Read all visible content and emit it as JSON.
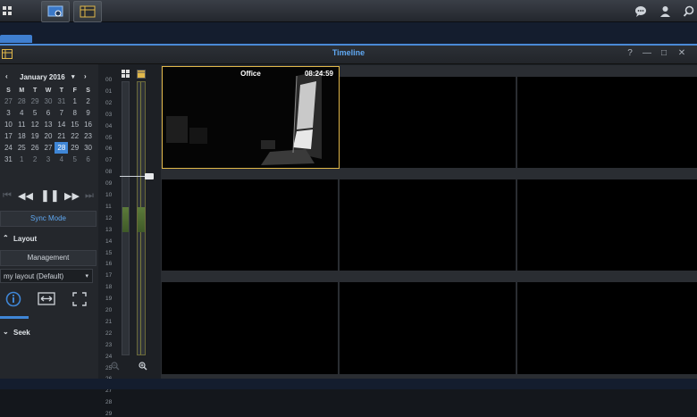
{
  "calendar": {
    "month_year": "January 2016",
    "weekdays": [
      "S",
      "M",
      "T",
      "W",
      "T",
      "F",
      "S"
    ],
    "weeks": [
      [
        "27",
        "28",
        "29",
        "30",
        "31",
        "1",
        "2"
      ],
      [
        "3",
        "4",
        "5",
        "6",
        "7",
        "8",
        "9"
      ],
      [
        "10",
        "11",
        "12",
        "13",
        "14",
        "15",
        "16"
      ],
      [
        "17",
        "18",
        "19",
        "20",
        "21",
        "22",
        "23"
      ],
      [
        "24",
        "25",
        "26",
        "27",
        "28",
        "29",
        "30"
      ],
      [
        "31",
        "1",
        "2",
        "3",
        "4",
        "5",
        "6"
      ]
    ],
    "selected_day": "28"
  },
  "left_panel": {
    "sync_mode": "Sync Mode",
    "layout_section": "Layout",
    "management": "Management",
    "layout_select": "my layout (Default)",
    "seek_section": "Seek"
  },
  "window": {
    "title": "Timeline"
  },
  "hours": [
    "00",
    "01",
    "02",
    "03",
    "04",
    "05",
    "06",
    "07",
    "08",
    "09",
    "10",
    "11",
    "12",
    "13",
    "14",
    "15",
    "16",
    "17",
    "18",
    "19",
    "20",
    "21",
    "22",
    "23",
    "24",
    "25",
    "26",
    "27",
    "28",
    "29"
  ],
  "camera": {
    "name": "Office",
    "time": "08:24:59"
  },
  "colors": {
    "accent": "#4a8ad6",
    "selected": "#3f86d6",
    "highlight": "#e1b84a"
  }
}
